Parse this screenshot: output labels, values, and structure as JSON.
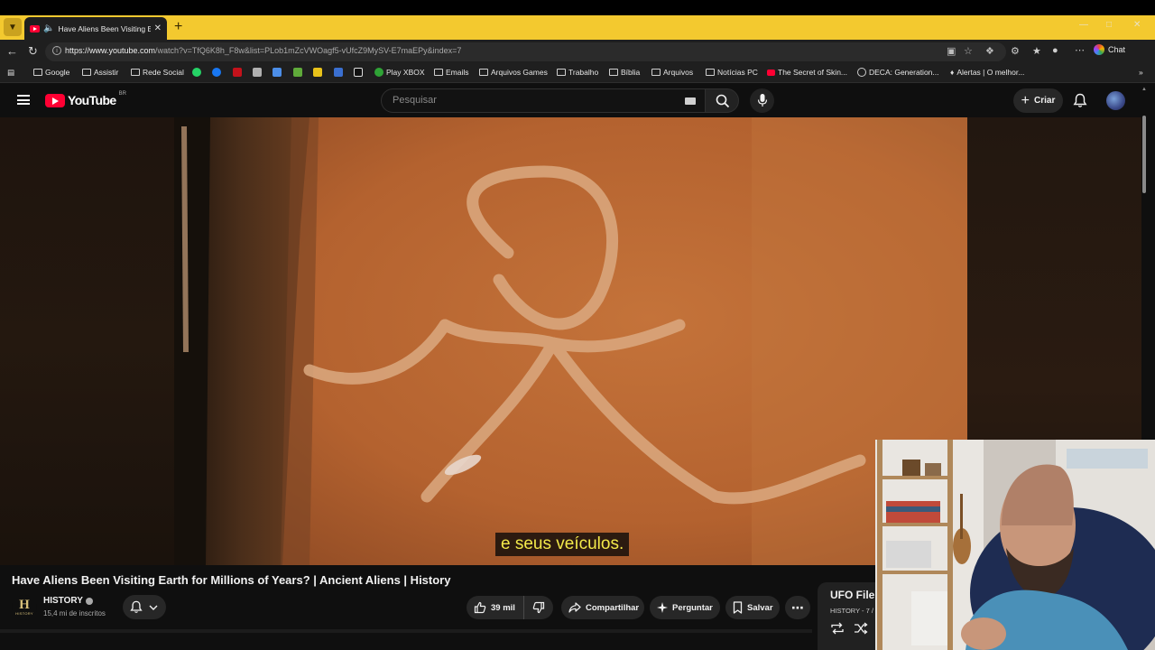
{
  "browser": {
    "tab_title": "Have Aliens Been Visiting Earth",
    "url_host": "https://www.youtube.com",
    "url_path": "/watch?v=TfQ6K8h_F8w&list=PLob1mZcVWOagf5-vUfcZ9MySV-E7maEPy&index=7",
    "chat_label": "Chat",
    "bookmarks": [
      "Google",
      "Assistir",
      "Rede Social",
      "Play XBOX",
      "Emails",
      "Arquivos Games",
      "Trabalho",
      "Bíblia",
      "Arquivos",
      "Notícias PC",
      "The Secret of Skin...",
      "DECA: Generation...",
      "Alertas | O melhor..."
    ]
  },
  "youtube": {
    "logo_text": "YouTube",
    "country_code": "BR",
    "search_placeholder": "Pesquisar",
    "create_label": "Criar"
  },
  "video": {
    "subtitle": "e seus veículos.",
    "title": "Have Aliens Been Visiting Earth for Millions of Years? | Ancient Aliens | History",
    "channel_name": "HISTORY",
    "channel_logo_letter": "H",
    "channel_logo_sub": "HISTORY",
    "subscribers": "15,4 mi de inscritos",
    "likes": "39 mil",
    "share_label": "Compartilhar",
    "ask_label": "Perguntar",
    "save_label": "Salvar"
  },
  "playlist": {
    "title": "UFO File",
    "subtitle": "HISTORY - 7 /"
  },
  "colors": {
    "youtube_red": "#ff0033",
    "tabstrip_yellow": "#f3c92f",
    "subtitle_yellow": "#f3e94a"
  }
}
